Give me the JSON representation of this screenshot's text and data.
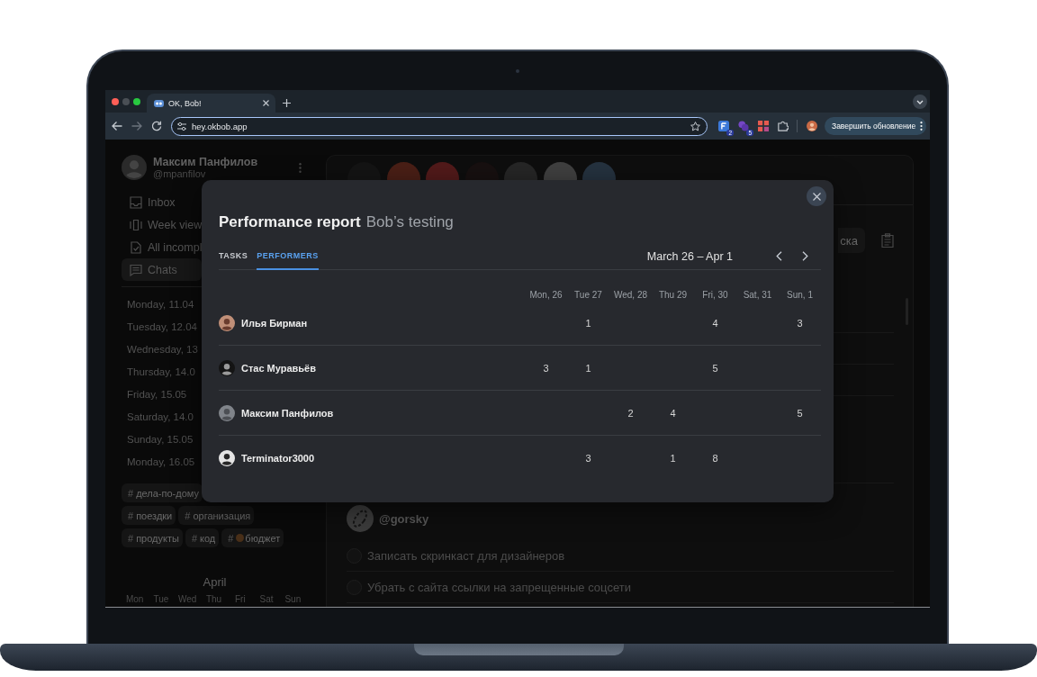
{
  "browser": {
    "tab_title": "OK, Bob!",
    "address": "hey.okbob.app",
    "extensions": [
      {
        "kind": "tile",
        "badge": "2"
      },
      {
        "kind": "blob",
        "badge": "5"
      },
      {
        "kind": "blocks"
      },
      {
        "kind": "puzzle"
      }
    ],
    "update_button": "Завершить обновление"
  },
  "sidebar": {
    "user": {
      "name": "Максим Панфилов",
      "handle": "@mpanfilov"
    },
    "nav": [
      {
        "kind": "inbox",
        "label": "Inbox",
        "selected": false
      },
      {
        "kind": "week",
        "label": "Week view",
        "selected": false
      },
      {
        "kind": "incomplete",
        "label": "All incompl",
        "selected": false
      },
      {
        "kind": "chats",
        "label": "Chats",
        "selected": true
      }
    ],
    "days": [
      "Monday, 11.04",
      "Tuesday, 12.04",
      "Wednesday, 13",
      "Thursday, 14.0",
      "Friday, 15.05",
      "Saturday, 14.0",
      "Sunday, 15.05",
      "Monday, 16.05"
    ],
    "tag_rows": [
      [
        {
          "kind": "plain",
          "hash": "#",
          "label": "дела-по-дому"
        }
      ],
      [
        {
          "kind": "plain",
          "hash": "#",
          "label": "поездки"
        },
        {
          "kind": "plain",
          "hash": "#",
          "label": "организация"
        }
      ],
      [
        {
          "kind": "plain",
          "hash": "#",
          "label": "продукты"
        },
        {
          "kind": "plain",
          "hash": "#",
          "label": "код"
        },
        {
          "kind": "emoji",
          "hash": "#",
          "label": "бюджет"
        }
      ]
    ],
    "calendar": {
      "month": "April",
      "weekdays": [
        "Mon",
        "Tue",
        "Wed",
        "Thu",
        "Fri",
        "Sat",
        "Sun"
      ]
    }
  },
  "main": {
    "board_button": "ска",
    "author": "@gorsky",
    "tasks": [
      {
        "text": "Записать скринкаст для дизайнеров",
        "checked": false
      },
      {
        "text": "Убрать с сайта ссылки на запрещенные соцсети",
        "checked": false
      }
    ]
  },
  "report": {
    "title": "Performance report",
    "subtitle": "Bob’s testing",
    "tabs": [
      {
        "label": "TASKS",
        "selected": false
      },
      {
        "label": "PERFORMERS",
        "selected": true
      }
    ],
    "period": "March 26 – Apr 1",
    "columns": [
      "Mon, 26",
      "Tue 27",
      "Wed, 28",
      "Thu 29",
      "Fri, 30",
      "Sat, 31",
      "Sun, 1"
    ],
    "rows": [
      {
        "name": "Илья Бирман",
        "tue": "1",
        "fri": "4",
        "sun": "3"
      },
      {
        "name": "Стас Муравьёв",
        "mon": "3",
        "tue": "1",
        "fri": "5"
      },
      {
        "name": "Максим Панфилов",
        "wed": "2",
        "thu": "4",
        "sun": "5"
      },
      {
        "name": "Terminator3000",
        "tue": "3",
        "thu": "1",
        "fri": "8"
      }
    ]
  }
}
